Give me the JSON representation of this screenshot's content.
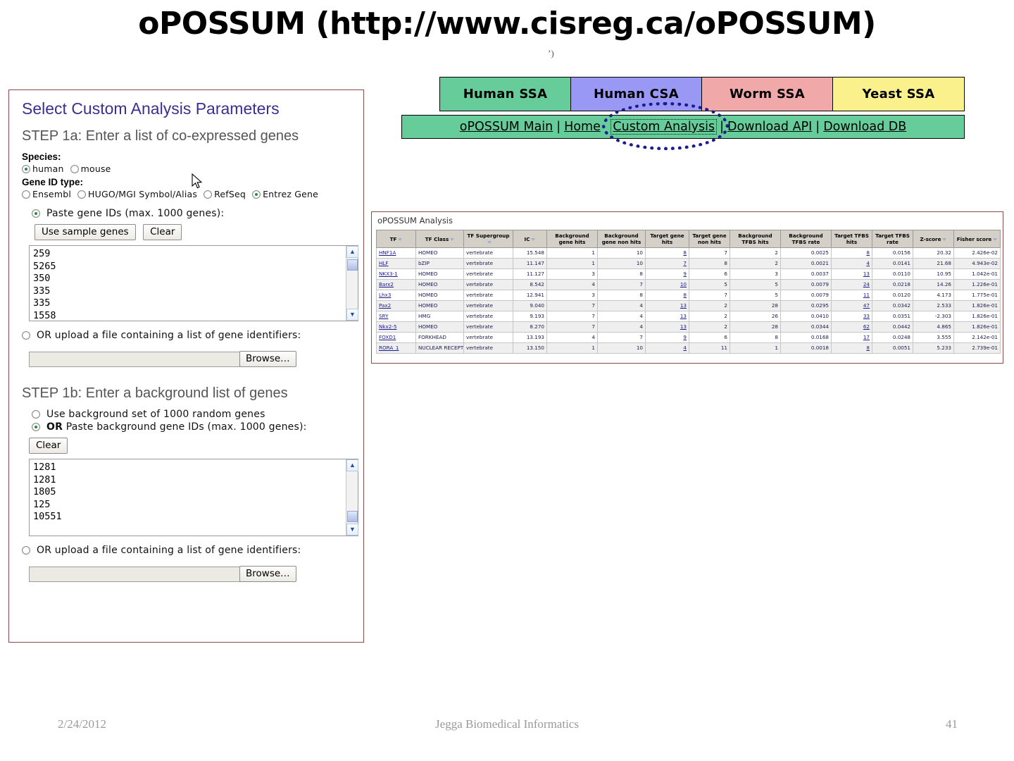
{
  "slide": {
    "title": "oPOSSUM (http://www.cisreg.ca/oPOSSUM)",
    "footer_date": "2/24/2012",
    "footer_center": "Jegga Biomedical Informatics",
    "footer_page": "41"
  },
  "form": {
    "panel_title": "Select Custom Analysis Parameters",
    "step1a": "STEP 1a: Enter a list of co-expressed genes",
    "species_label": "Species:",
    "species_options": [
      {
        "label": "human",
        "selected": true
      },
      {
        "label": "mouse",
        "selected": false
      }
    ],
    "gene_id_label": "Gene ID type:",
    "gene_id_options": [
      {
        "label": "Ensembl",
        "selected": false
      },
      {
        "label": "HUGO/MGI Symbol/Alias",
        "selected": false
      },
      {
        "label": "RefSeq",
        "selected": false
      },
      {
        "label": "Entrez Gene",
        "selected": true
      }
    ],
    "paste_option": "Paste gene IDs (max. 1000 genes):",
    "use_sample_btn": "Use sample genes",
    "clear_btn": "Clear",
    "gene_ids_value": "259\n5265\n350\n335\n335\n1558",
    "upload_option": "OR upload a file containing a list of gene identifiers:",
    "upload_bold": "OR",
    "browse_btn": "Browse…",
    "file_value": "",
    "step1b": "STEP 1b: Enter a background list of genes",
    "bg_random_option": "Use background set of 1000 random genes",
    "bg_paste_option": "Paste background gene IDs (max. 1000 genes):",
    "bg_paste_bold": "OR",
    "bg_clear_btn": "Clear",
    "bg_ids_value": "1281\n1281\n1805\n125\n10551",
    "bg_upload_option": "OR upload a file containing a list of gene identifiers:",
    "bg_upload_bold": "OR",
    "bg_browse_btn": "Browse…"
  },
  "nav": {
    "tabs": [
      {
        "label": "Human SSA",
        "color": "#66cc99"
      },
      {
        "label": "Human CSA",
        "color": "#9999f5"
      },
      {
        "label": "Worm SSA",
        "color": "#f0a8a8"
      },
      {
        "label": "Yeast SSA",
        "color": "#faf08c"
      }
    ],
    "links": [
      "oPOSSUM Main",
      "Home",
      "Custom Analysis",
      "Download API",
      "Download DB"
    ],
    "separator": "|",
    "highlighted_link": "Custom Analysis",
    "bar_color": "#66cc99",
    "annotation_color": "#1b1b8f"
  },
  "results": {
    "panel_title": "oPOSSUM Analysis",
    "columns": [
      "TF",
      "TF Class",
      "TF Supergroup",
      "IC",
      "Background gene hits",
      "Background gene non hits",
      "Target gene hits",
      "Target gene non hits",
      "Background TFBS hits",
      "Background TFBS rate",
      "Target TFBS hits",
      "Target TFBS rate",
      "Z-score",
      "Fisher score"
    ],
    "rows": [
      {
        "tf": "HNF1A",
        "tf_class": "HOMEO",
        "supergroup": "vertebrate",
        "ic": "15.548",
        "bg_gene_hits": "1",
        "bg_gene_non_hits": "10",
        "target_gene_hits": "8",
        "target_gene_non_hits": "7",
        "bg_tfbs_hits": "2",
        "bg_tfbs_rate": "0.0025",
        "target_tfbs_hits": "8",
        "target_tfbs_rate": "0.0156",
        "z_score": "20.32",
        "fisher": "2.426e-02"
      },
      {
        "tf": "HLF",
        "tf_class": "bZIP",
        "supergroup": "vertebrate",
        "ic": "11.147",
        "bg_gene_hits": "1",
        "bg_gene_non_hits": "10",
        "target_gene_hits": "7",
        "target_gene_non_hits": "8",
        "bg_tfbs_hits": "2",
        "bg_tfbs_rate": "0.0021",
        "target_tfbs_hits": "4",
        "target_tfbs_rate": "0.0141",
        "z_score": "21.68",
        "fisher": "4.943e-02"
      },
      {
        "tf": "NKX3-1",
        "tf_class": "HOMEO",
        "supergroup": "vertebrate",
        "ic": "11.127",
        "bg_gene_hits": "3",
        "bg_gene_non_hits": "8",
        "target_gene_hits": "9",
        "target_gene_non_hits": "6",
        "bg_tfbs_hits": "3",
        "bg_tfbs_rate": "0.0037",
        "target_tfbs_hits": "13",
        "target_tfbs_rate": "0.0110",
        "z_score": "10.95",
        "fisher": "1.042e-01"
      },
      {
        "tf": "Barx2",
        "tf_class": "HOMEO",
        "supergroup": "vertebrate",
        "ic": "8.542",
        "bg_gene_hits": "4",
        "bg_gene_non_hits": "7",
        "target_gene_hits": "10",
        "target_gene_non_hits": "5",
        "bg_tfbs_hits": "5",
        "bg_tfbs_rate": "0.0079",
        "target_tfbs_hits": "24",
        "target_tfbs_rate": "0.0218",
        "z_score": "14.26",
        "fisher": "1.226e-01"
      },
      {
        "tf": "Lhx3",
        "tf_class": "HOMEO",
        "supergroup": "vertebrate",
        "ic": "12.941",
        "bg_gene_hits": "3",
        "bg_gene_non_hits": "8",
        "target_gene_hits": "8",
        "target_gene_non_hits": "7",
        "bg_tfbs_hits": "5",
        "bg_tfbs_rate": "0.0079",
        "target_tfbs_hits": "11",
        "target_tfbs_rate": "0.0120",
        "z_score": "4.173",
        "fisher": "1.775e-01"
      },
      {
        "tf": "Pax2",
        "tf_class": "HOMEO",
        "supergroup": "vertebrate",
        "ic": "9.040",
        "bg_gene_hits": "7",
        "bg_gene_non_hits": "4",
        "target_gene_hits": "13",
        "target_gene_non_hits": "2",
        "bg_tfbs_hits": "28",
        "bg_tfbs_rate": "0.0295",
        "target_tfbs_hits": "47",
        "target_tfbs_rate": "0.0342",
        "z_score": "2.533",
        "fisher": "1.826e-01"
      },
      {
        "tf": "SRY",
        "tf_class": "HMG",
        "supergroup": "vertebrate",
        "ic": "9.193",
        "bg_gene_hits": "7",
        "bg_gene_non_hits": "4",
        "target_gene_hits": "13",
        "target_gene_non_hits": "2",
        "bg_tfbs_hits": "26",
        "bg_tfbs_rate": "0.0410",
        "target_tfbs_hits": "33",
        "target_tfbs_rate": "0.0351",
        "z_score": "-2.303",
        "fisher": "1.826e-01"
      },
      {
        "tf": "Nkx2-5",
        "tf_class": "HOMEO",
        "supergroup": "vertebrate",
        "ic": "8.270",
        "bg_gene_hits": "7",
        "bg_gene_non_hits": "4",
        "target_gene_hits": "13",
        "target_gene_non_hits": "2",
        "bg_tfbs_hits": "28",
        "bg_tfbs_rate": "0.0344",
        "target_tfbs_hits": "62",
        "target_tfbs_rate": "0.0442",
        "z_score": "4.865",
        "fisher": "1.826e-01"
      },
      {
        "tf": "FOXD1",
        "tf_class": "FORKHEAD",
        "supergroup": "vertebrate",
        "ic": "13.193",
        "bg_gene_hits": "4",
        "bg_gene_non_hits": "7",
        "target_gene_hits": "9",
        "target_gene_non_hits": "6",
        "bg_tfbs_hits": "8",
        "bg_tfbs_rate": "0.0168",
        "target_tfbs_hits": "17",
        "target_tfbs_rate": "0.0248",
        "z_score": "3.555",
        "fisher": "2.142e-01"
      },
      {
        "tf": "RORA_1",
        "tf_class": "NUCLEAR RECEPTOR",
        "supergroup": "vertebrate",
        "ic": "13.150",
        "bg_gene_hits": "1",
        "bg_gene_non_hits": "10",
        "target_gene_hits": "4",
        "target_gene_non_hits": "11",
        "bg_tfbs_hits": "1",
        "bg_tfbs_rate": "0.0018",
        "target_tfbs_hits": "8",
        "target_tfbs_rate": "0.0051",
        "z_score": "5.233",
        "fisher": "2.739e-01"
      }
    ]
  }
}
